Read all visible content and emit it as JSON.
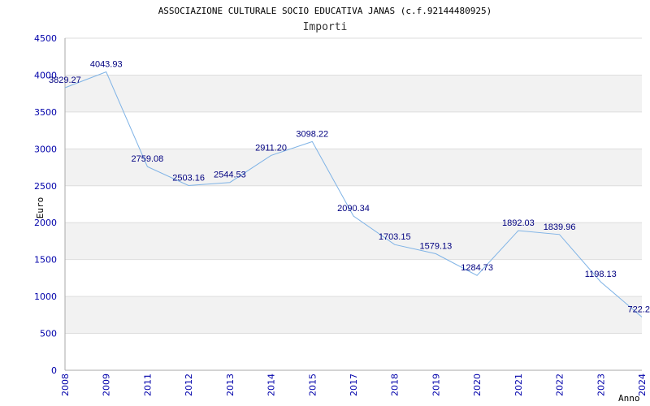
{
  "chart_data": {
    "type": "line",
    "title": "ASSOCIAZIONE CULTURALE SOCIO EDUCATIVA JANAS (c.f.92144480925)",
    "subtitle": "Importi",
    "xlabel": "Anno",
    "ylabel": "Euro",
    "ylim": [
      0,
      4500
    ],
    "yticks": [
      "0",
      "500",
      "1000",
      "1500",
      "2000",
      "2500",
      "3000",
      "3500",
      "4000",
      "4500"
    ],
    "categories": [
      "2008",
      "2009",
      "2011",
      "2012",
      "2013",
      "2014",
      "2015",
      "2017",
      "2018",
      "2019",
      "2020",
      "2021",
      "2022",
      "2023",
      "2024"
    ],
    "values": [
      3829.27,
      4043.93,
      2759.08,
      2503.16,
      2544.53,
      2911.2,
      3098.22,
      2090.34,
      1703.15,
      1579.13,
      1284.73,
      1892.03,
      1839.96,
      1198.13,
      722.2
    ],
    "value_labels": [
      "3829.27",
      "4043.93",
      "2759.08",
      "2503.16",
      "2544.53",
      "2911.20",
      "3098.22",
      "2090.34",
      "1703.15",
      "1579.13",
      "1284.73",
      "1892.03",
      "1839.96",
      "1198.13",
      "722.2"
    ],
    "grid": true,
    "legend": "none",
    "colors": {
      "line": "#7fb3e6",
      "tick_text": "#0000aa",
      "data_label": "#000080",
      "band": "#f2f2f2",
      "grid": "#dddddd",
      "axis": "#aaaaaa"
    }
  }
}
